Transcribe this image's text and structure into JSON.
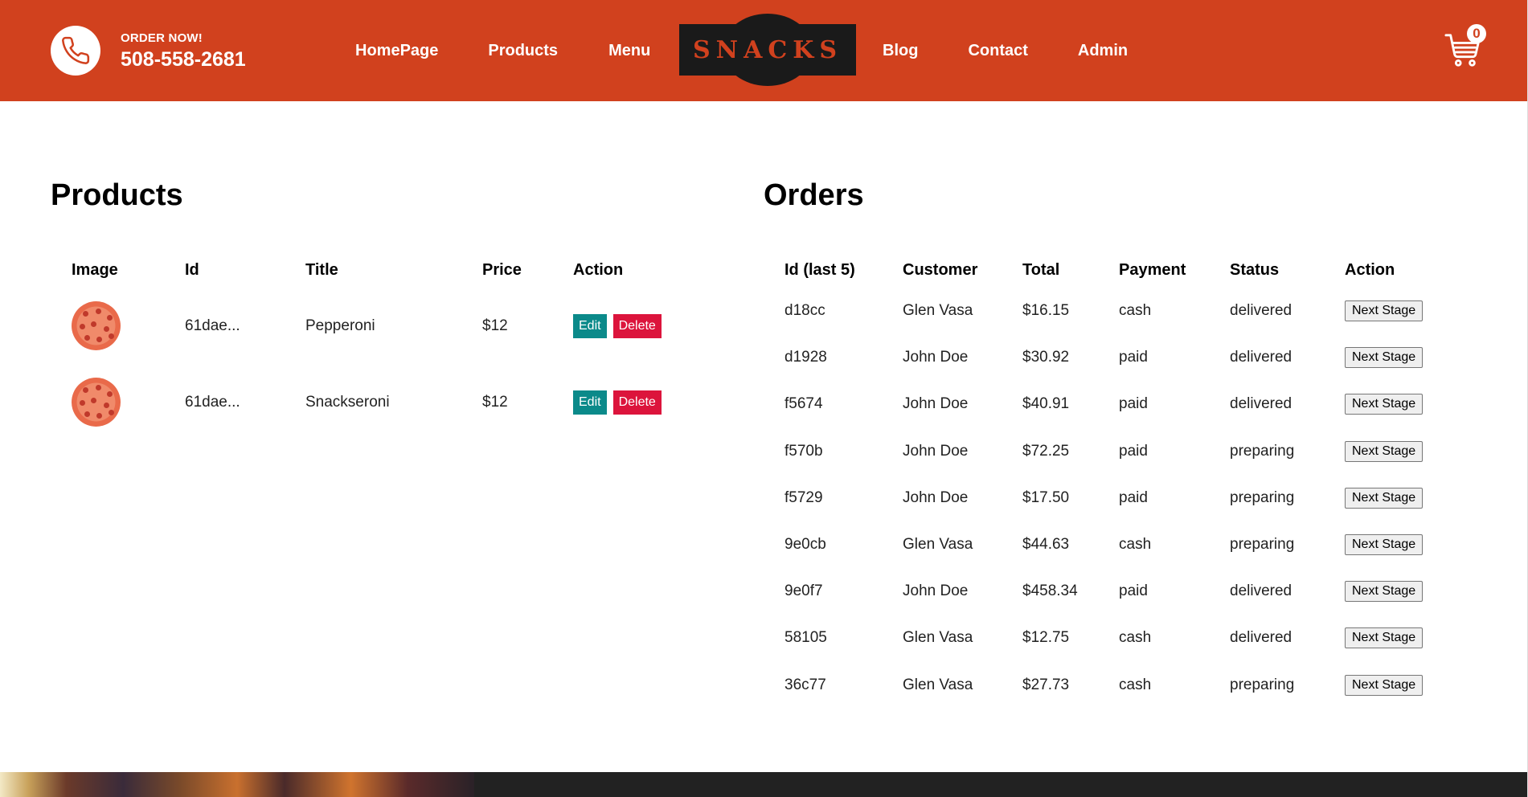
{
  "header": {
    "order_now": "ORDER NOW!",
    "phone": "508-558-2681",
    "nav_left": [
      "HomePage",
      "Products",
      "Menu"
    ],
    "logo": "SNACKS",
    "nav_right": [
      "Blog",
      "Contact",
      "Admin"
    ],
    "cart_count": "0"
  },
  "products": {
    "title": "Products",
    "headers": [
      "Image",
      "Id",
      "Title",
      "Price",
      "Action"
    ],
    "rows": [
      {
        "id": "61dae...",
        "title": "Pepperoni",
        "price": "$12",
        "edit": "Edit",
        "delete": "Delete"
      },
      {
        "id": "61dae...",
        "title": "Snackseroni",
        "price": "$12",
        "edit": "Edit",
        "delete": "Delete"
      }
    ]
  },
  "orders": {
    "title": "Orders",
    "headers": [
      "Id (last 5)",
      "Customer",
      "Total",
      "Payment",
      "Status",
      "Action"
    ],
    "action_label": "Next Stage",
    "rows": [
      {
        "id": "d18cc",
        "customer": "Glen Vasa",
        "total": "$16.15",
        "payment": "cash",
        "status": "delivered"
      },
      {
        "id": "d1928",
        "customer": "John Doe",
        "total": "$30.92",
        "payment": "paid",
        "status": "delivered"
      },
      {
        "id": "f5674",
        "customer": "John Doe",
        "total": "$40.91",
        "payment": "paid",
        "status": "delivered"
      },
      {
        "id": "f570b",
        "customer": "John Doe",
        "total": "$72.25",
        "payment": "paid",
        "status": "preparing"
      },
      {
        "id": "f5729",
        "customer": "John Doe",
        "total": "$17.50",
        "payment": "paid",
        "status": "preparing"
      },
      {
        "id": "9e0cb",
        "customer": "Glen Vasa",
        "total": "$44.63",
        "payment": "cash",
        "status": "preparing"
      },
      {
        "id": "9e0f7",
        "customer": "John Doe",
        "total": "$458.34",
        "payment": "paid",
        "status": "delivered"
      },
      {
        "id": "58105",
        "customer": "Glen Vasa",
        "total": "$12.75",
        "payment": "cash",
        "status": "delivered"
      },
      {
        "id": "36c77",
        "customer": "Glen Vasa",
        "total": "$27.73",
        "payment": "cash",
        "status": "preparing"
      }
    ]
  },
  "colors": {
    "brand": "#d1411e",
    "edit": "#0b8a8a",
    "delete": "#dc143c",
    "logo_bg": "#1a1a1a",
    "footer": "#222222"
  },
  "icons": {
    "phone": "phone-icon",
    "cart": "cart-icon",
    "product_image": "pizza-image"
  }
}
